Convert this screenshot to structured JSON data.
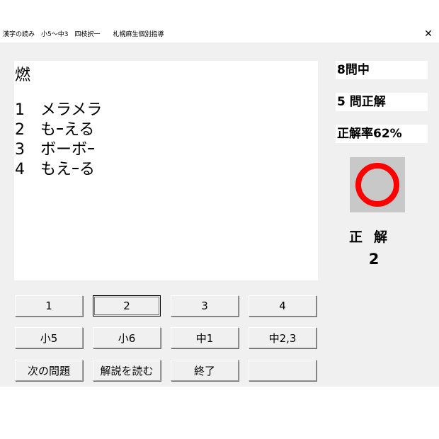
{
  "window": {
    "title": "漢字の読み　小5～中3　四枝択一　　札幌麻生個別指導",
    "close_glyph": "✕"
  },
  "question": {
    "kanji": "燃",
    "choices": [
      "1　メラメラ",
      "2　もｰえる",
      "3　ボーボｰ",
      "4　もえｰる"
    ]
  },
  "stats": {
    "total": "8問中",
    "correct": "5 問正解",
    "rate": "正解率62%"
  },
  "result": {
    "mark": "circle",
    "mark_color": "#ff0000",
    "label": "正解",
    "number": "2"
  },
  "buttons": {
    "row1": [
      "1",
      "2",
      "3",
      "4"
    ],
    "row2": [
      "小5",
      "小6",
      "中1",
      "中2,3"
    ],
    "row3": [
      "次の問題",
      "解説を読む",
      "終了",
      ""
    ]
  }
}
